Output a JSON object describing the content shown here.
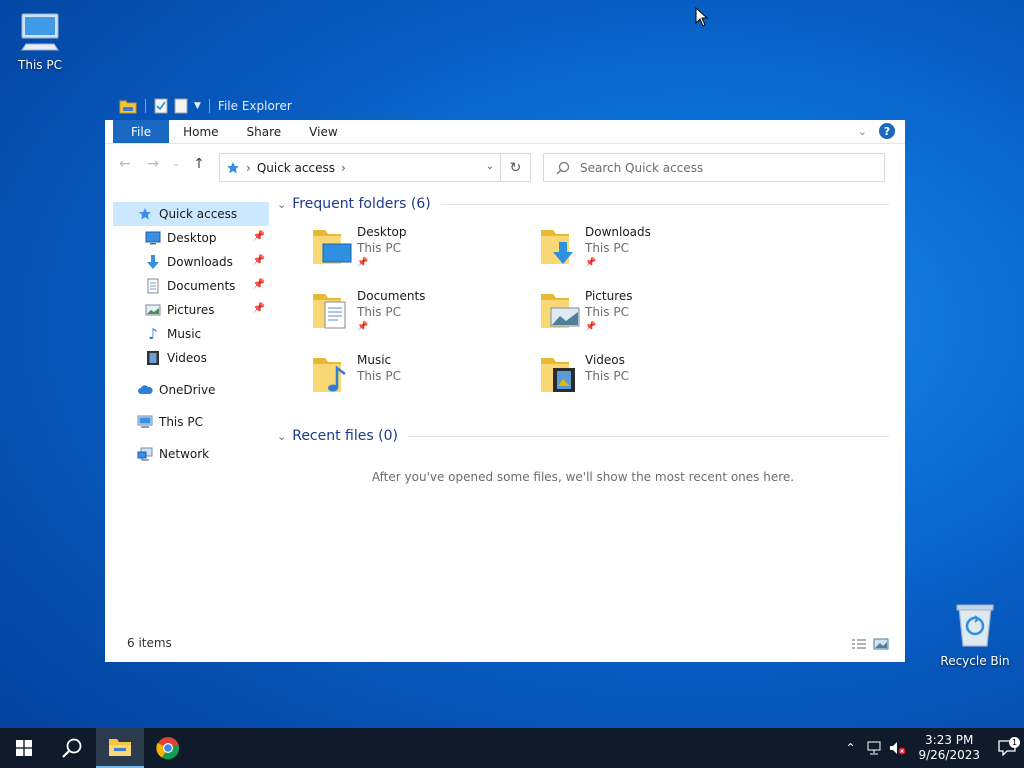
{
  "desktop": {
    "icons": [
      {
        "label": "This PC"
      },
      {
        "label": "Recycle Bin"
      }
    ]
  },
  "window": {
    "title": "File Explorer",
    "ribbon": {
      "tabs": [
        "File",
        "Home",
        "Share",
        "View"
      ]
    },
    "help_label": "?",
    "address": {
      "root_label": "Quick access"
    },
    "search": {
      "placeholder": "Search Quick access"
    }
  },
  "sidebar": {
    "quick_access": "Quick access",
    "pinned": [
      {
        "label": "Desktop",
        "icon": "desktop-icon",
        "pinned": true
      },
      {
        "label": "Downloads",
        "icon": "downloads-icon",
        "pinned": true
      },
      {
        "label": "Documents",
        "icon": "documents-icon",
        "pinned": true
      },
      {
        "label": "Pictures",
        "icon": "pictures-icon",
        "pinned": true
      },
      {
        "label": "Music",
        "icon": "music-icon",
        "pinned": false
      },
      {
        "label": "Videos",
        "icon": "videos-icon",
        "pinned": false
      }
    ],
    "onedrive": "OneDrive",
    "this_pc": "This PC",
    "network": "Network"
  },
  "main": {
    "frequent_title": "Frequent folders (6)",
    "folders": [
      {
        "name": "Desktop",
        "location": "This PC",
        "pinned": true
      },
      {
        "name": "Downloads",
        "location": "This PC",
        "pinned": true
      },
      {
        "name": "Documents",
        "location": "This PC",
        "pinned": true
      },
      {
        "name": "Pictures",
        "location": "This PC",
        "pinned": true
      },
      {
        "name": "Music",
        "location": "This PC",
        "pinned": false
      },
      {
        "name": "Videos",
        "location": "This PC",
        "pinned": false
      }
    ],
    "recent_title": "Recent files (0)",
    "recent_empty": "After you've opened some files, we'll show the most recent ones here."
  },
  "status": {
    "items": "6 items"
  },
  "taskbar": {
    "time": "3:23 PM",
    "date": "9/26/2023",
    "notification_count": "1"
  },
  "colors": {
    "accent": "#1969c3",
    "selected": "#cce8ff",
    "section_heading": "#1e3a8a",
    "taskbar": "#0f1b2b"
  }
}
